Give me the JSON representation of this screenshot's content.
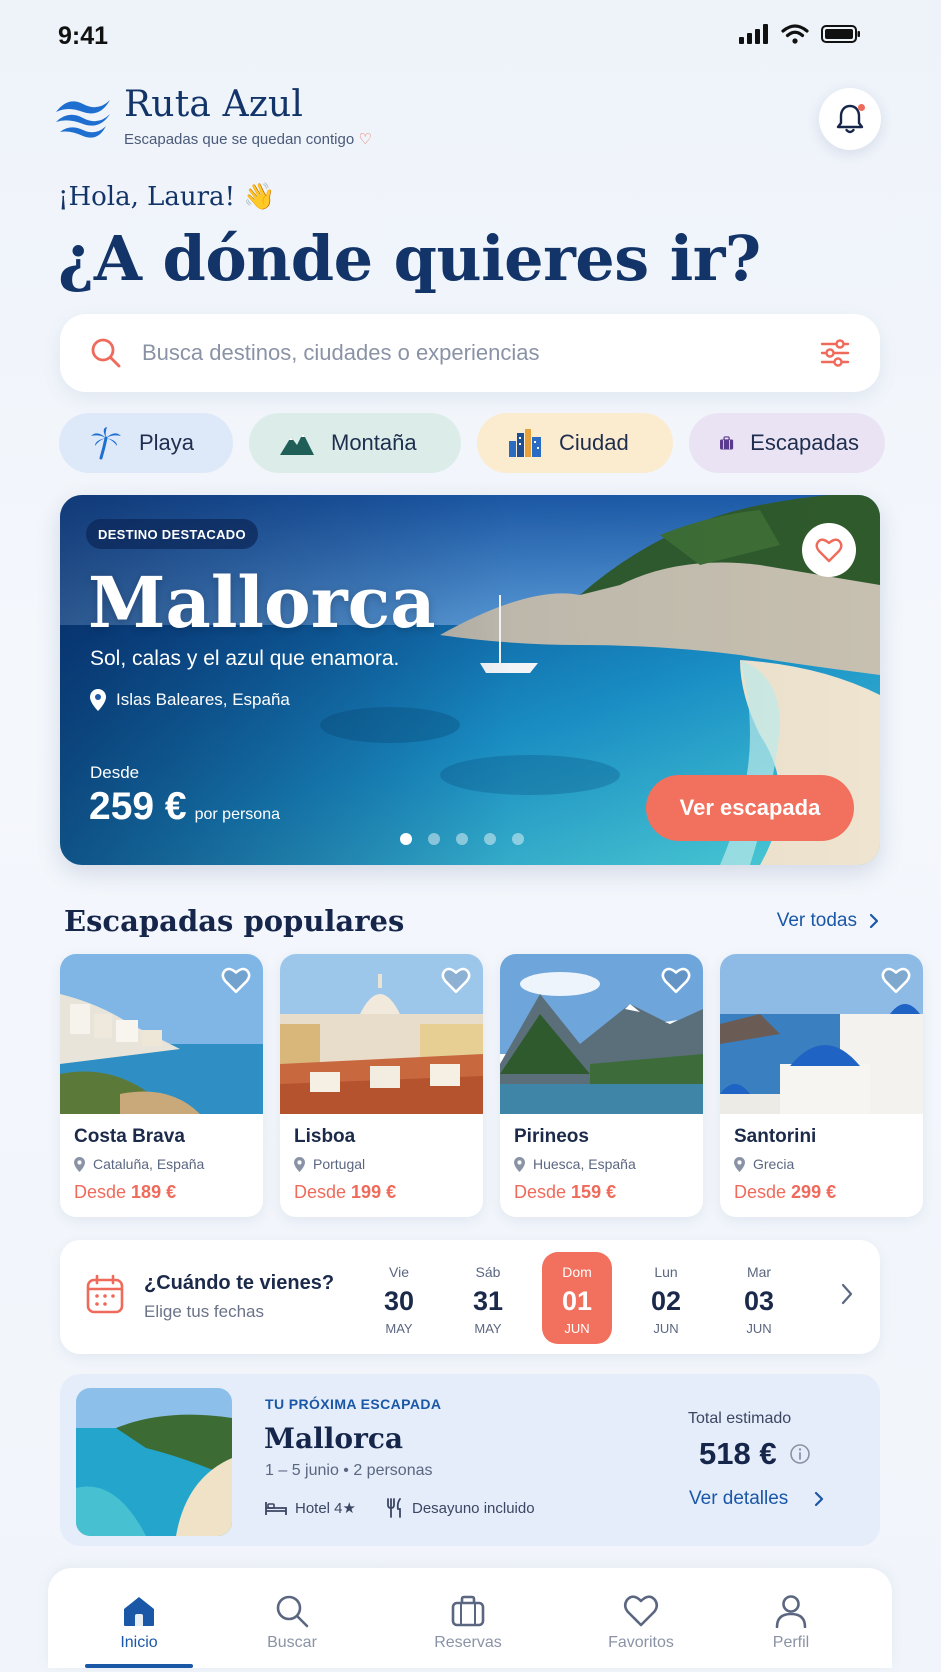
{
  "status": {
    "time": "9:41"
  },
  "brand": {
    "name": "Ruta Azul",
    "tagline": "Escapadas que se quedan contigo",
    "tagline_heart": "♡"
  },
  "greeting": "¡Hola, Laura! 👋",
  "headline": "¿A dónde quieres ir?",
  "search": {
    "placeholder": "Busca destinos, ciudades o experiencias",
    "value": ""
  },
  "categories": [
    {
      "label": "Playa",
      "icon": "palm-tree-icon"
    },
    {
      "label": "Montaña",
      "icon": "mountain-icon"
    },
    {
      "label": "Ciudad",
      "icon": "city-icon"
    },
    {
      "label": "Escapadas",
      "icon": "suitcase-icon"
    }
  ],
  "featured": {
    "badge": "DESTINO DESTACADO",
    "title": "Mallorca",
    "subtitle": "Sol, calas y el azul que enamora.",
    "location": "Islas Baleares, España",
    "from_label": "Desde",
    "price": "259 €",
    "price_unit": "por persona",
    "cta": "Ver escapada",
    "carousel_pages": 5,
    "carousel_active": 1
  },
  "popular": {
    "title": "Escapadas populares",
    "see_all": "Ver todas",
    "items": [
      {
        "name": "Costa Brava",
        "location": "Cataluña, España",
        "from": "Desde",
        "price": "189 €"
      },
      {
        "name": "Lisboa",
        "location": "Portugal",
        "from": "Desde",
        "price": "199 €"
      },
      {
        "name": "Pirineos",
        "location": "Huesca, España",
        "from": "Desde",
        "price": "159 €"
      },
      {
        "name": "Santorini",
        "location": "Grecia",
        "from": "Desde",
        "price": "299 €"
      }
    ]
  },
  "dates": {
    "title": "¿Cuándo te vienes?",
    "subtitle": "Elige tus fechas",
    "days": [
      {
        "dow": "Vie",
        "num": "30",
        "month": "MAY"
      },
      {
        "dow": "Sáb",
        "num": "31",
        "month": "MAY"
      },
      {
        "dow": "Dom",
        "num": "01",
        "month": "JUN",
        "selected": true
      },
      {
        "dow": "Lun",
        "num": "02",
        "month": "JUN"
      },
      {
        "dow": "Mar",
        "num": "03",
        "month": "JUN"
      }
    ]
  },
  "next_trip": {
    "label": "TU PRÓXIMA ESCAPADA",
    "title": "Mallorca",
    "meta": "1 – 5 junio • 2 personas",
    "amenity_hotel": "Hotel 4★",
    "amenity_breakfast": "Desayuno incluido",
    "total_label": "Total estimado",
    "total": "518 €",
    "details": "Ver detalles"
  },
  "tabs": [
    {
      "label": "Inicio",
      "active": true
    },
    {
      "label": "Buscar"
    },
    {
      "label": "Reservas"
    },
    {
      "label": "Favoritos"
    },
    {
      "label": "Perfil"
    }
  ],
  "colors": {
    "primary": "#123468",
    "accent": "#f2705e",
    "link": "#1a57a6"
  }
}
